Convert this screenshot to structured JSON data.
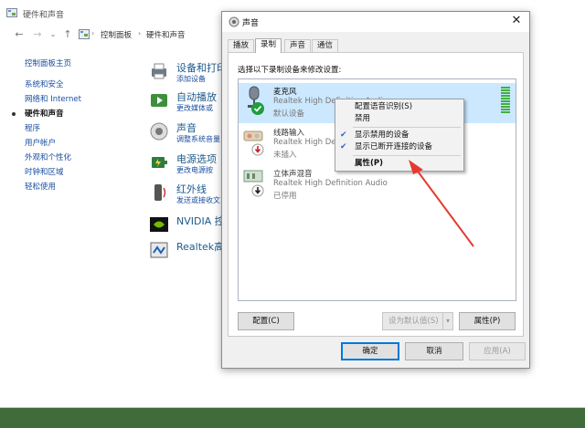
{
  "control_panel": {
    "window_title": "硬件和声音",
    "breadcrumb": [
      "控制面板",
      "硬件和声音"
    ],
    "sidebar": [
      {
        "label": "控制面板主页"
      },
      {
        "label": "系统和安全"
      },
      {
        "label": "网络和 Internet"
      },
      {
        "label": "硬件和声音"
      },
      {
        "label": "程序"
      },
      {
        "label": "用户帐户"
      },
      {
        "label": "外观和个性化"
      },
      {
        "label": "时钟和区域"
      },
      {
        "label": "轻松使用"
      }
    ],
    "categories": [
      {
        "title": "设备和打印",
        "sub": "添加设备"
      },
      {
        "title": "自动播放",
        "sub": "更改媒体或"
      },
      {
        "title": "声音",
        "sub": "调整系统音量"
      },
      {
        "title": "电源选项",
        "sub": "更改电源按"
      },
      {
        "title": "红外线",
        "sub": "发送或接收文"
      },
      {
        "title": "NVIDIA 控",
        "sub": ""
      },
      {
        "title": "Realtek高",
        "sub": ""
      }
    ]
  },
  "dialog": {
    "title": "声音",
    "tabs": [
      "播放",
      "录制",
      "声音",
      "通信"
    ],
    "instruction": "选择以下录制设备来修改设置:",
    "devices": [
      {
        "name": "麦克风",
        "driver": "Realtek High Definition Audio",
        "status": "默认设备"
      },
      {
        "name": "线路输入",
        "driver": "Realtek High Definition Audio",
        "status": "未插入"
      },
      {
        "name": "立体声混音",
        "driver": "Realtek High Definition Audio",
        "status": "已停用"
      }
    ],
    "buttons": {
      "configure": "配置(C)",
      "set_default": "设为默认值(S)",
      "properties": "属性(P)",
      "ok": "确定",
      "cancel": "取消",
      "apply": "应用(A)"
    }
  },
  "context_menu": {
    "items": [
      {
        "label": "配置语音识别(S)"
      },
      {
        "label": "禁用"
      },
      {
        "label": "显示禁用的设备",
        "checked": true
      },
      {
        "label": "显示已断开连接的设备",
        "checked": true
      },
      {
        "label": "属性(P)"
      }
    ]
  },
  "colors": {
    "selection": "#cce8ff",
    "annotation_arrow": "#e53a2f",
    "default_button_border": "#0078d7"
  }
}
